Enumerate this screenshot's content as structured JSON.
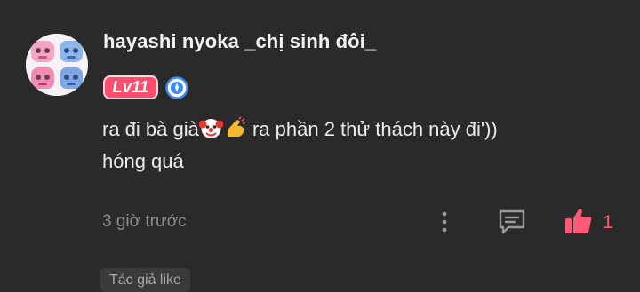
{
  "comment": {
    "username": "hayashi nyoka _chị sinh đôi_",
    "level_label": "Lv11",
    "text_part1": "ra đi bà già",
    "text_part2": " ra phần 2 thử thách này đi'))",
    "text_line2": "hóng quá",
    "emojis": [
      "clown-face-emoji",
      "flexed-biceps-emoji"
    ],
    "timestamp": "3 giờ trước",
    "like_count": "1",
    "author_liked_label": "Tác giả like"
  },
  "icons": [
    "avatar",
    "verified-badge-icon",
    "more-icon",
    "reply-icon",
    "like-icon"
  ],
  "colors": {
    "background": "#2a2a2a",
    "username": "#f2f2f2",
    "text": "#ececec",
    "muted": "#8e8e8e",
    "accent": "#ff5a76",
    "level_badge": "#ff4d6d",
    "verified": "#3d8bf2"
  }
}
